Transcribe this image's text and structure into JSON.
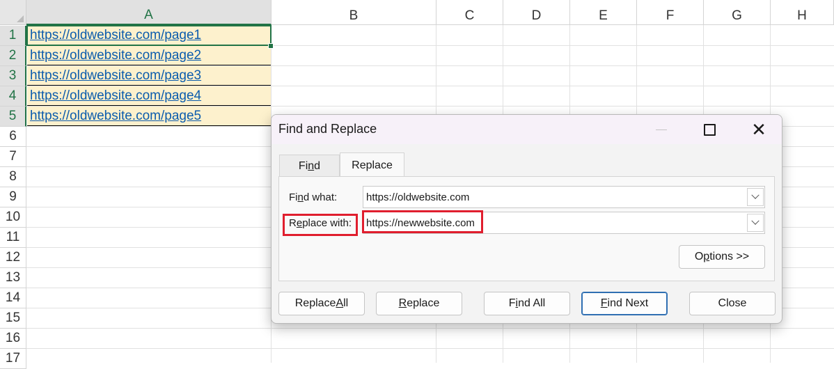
{
  "sheet": {
    "columns": [
      "A",
      "B",
      "C",
      "D",
      "E",
      "F",
      "G",
      "H"
    ],
    "rows": [
      "1",
      "2",
      "3",
      "4",
      "5",
      "6",
      "7",
      "8",
      "9",
      "10",
      "11",
      "12",
      "13",
      "14",
      "15",
      "16",
      "17"
    ],
    "cells": [
      "https://oldwebsite.com/page1",
      "https://oldwebsite.com/page2",
      "https://oldwebsite.com/page3",
      "https://oldwebsite.com/page4",
      "https://oldwebsite.com/page5"
    ],
    "colors": {
      "cell_fill": "#fdf1cd",
      "link": "#0b5cad",
      "selection": "#217346"
    }
  },
  "dialog": {
    "title": "Find and Replace",
    "tabs": {
      "find": {
        "pre": "Fi",
        "key": "n",
        "post": "d"
      },
      "replace": {
        "label": "Replace"
      }
    },
    "find_what": {
      "pre": "Fi",
      "key": "n",
      "post": "d what:",
      "value": "https://oldwebsite.com"
    },
    "replace_with": {
      "pre": "R",
      "key": "e",
      "post": "place with:",
      "value": "https://newwebsite.com"
    },
    "buttons": {
      "options": {
        "pre": "O",
        "key": "p",
        "post": "tions >>"
      },
      "replace_all": {
        "pre": "Replace ",
        "key": "A",
        "post": "ll"
      },
      "replace": {
        "pre": "",
        "key": "R",
        "post": "eplace"
      },
      "find_all": {
        "pre": "F",
        "key": "i",
        "post": "nd All"
      },
      "find_next": {
        "pre": "",
        "key": "F",
        "post": "ind Next"
      },
      "close": {
        "label": "Close"
      }
    },
    "icons": [
      "minimize-icon",
      "maximize-icon",
      "close-icon",
      "chevron-down-icon"
    ],
    "highlight_color": "#e01e2e"
  }
}
